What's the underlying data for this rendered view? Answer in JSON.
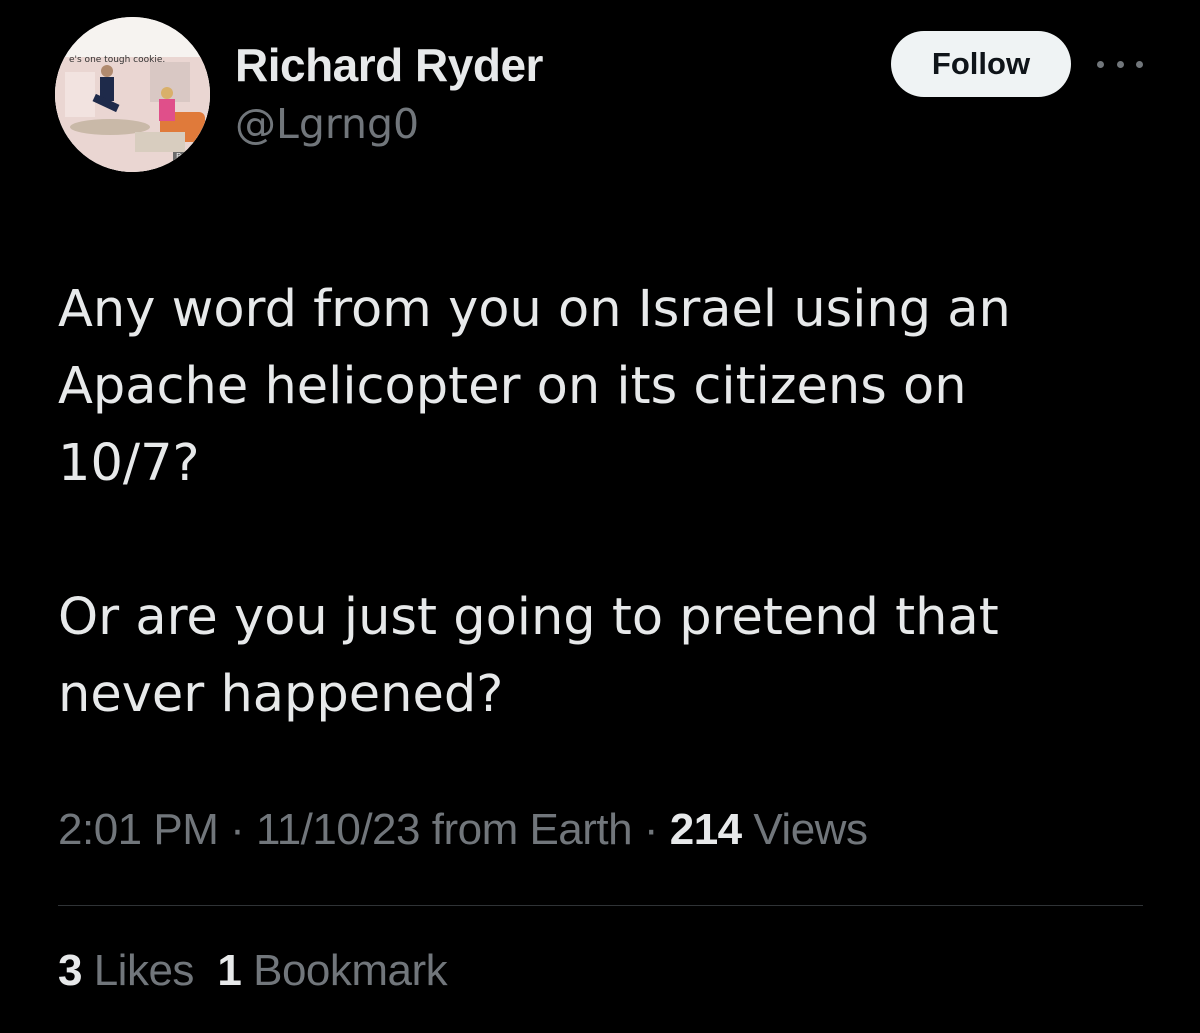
{
  "user": {
    "display_name": "Richard Ryder",
    "handle": "@Lgrng0",
    "avatar_caption": "e's one tough cookie.",
    "avatar_badge": "BRAZZE"
  },
  "actions": {
    "follow_label": "Follow",
    "more_icon": "more-horizontal-icon"
  },
  "tweet": {
    "paragraph1": "Any word from you on Israel using an\nApache helicopter on its citizens on\n10/7?",
    "paragraph2": "Or are you just going to pretend that\nnever happened?"
  },
  "meta": {
    "time": "2:01 PM",
    "separator": " · ",
    "date": "11/10/23",
    "source": " from Earth",
    "views_count": "214",
    "views_label": " Views"
  },
  "stats": {
    "likes_count": "3",
    "likes_label": " Likes",
    "bookmarks_count": "1",
    "bookmarks_label": " Bookmark"
  },
  "colors": {
    "background": "#000000",
    "primary_text": "#e7e9ea",
    "secondary_text": "#71767b",
    "follow_bg": "#eff3f4",
    "divider": "#2f3336"
  }
}
